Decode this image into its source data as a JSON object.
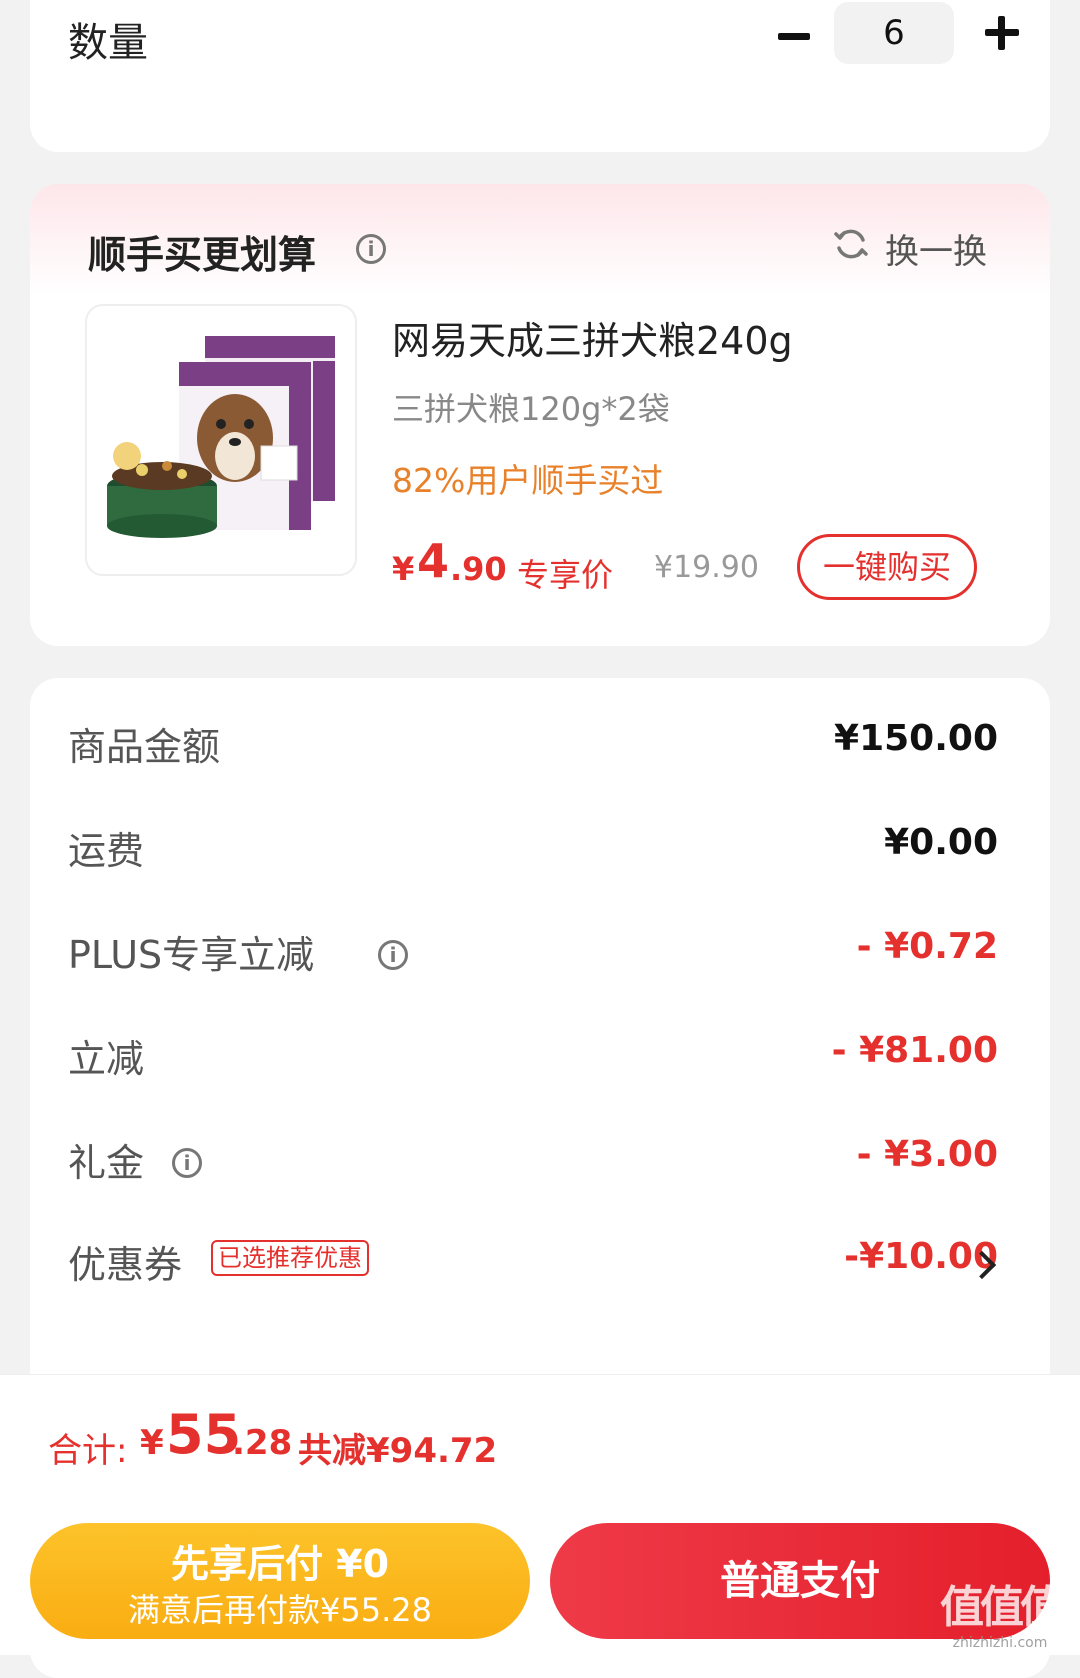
{
  "quantity": {
    "label": "数量",
    "value": "6"
  },
  "upsell": {
    "title": "顺手买更划算",
    "swap_label": "换一换",
    "product": {
      "name": "网易天成三拼犬粮240g",
      "spec": "三拼犬粮120g*2袋",
      "social_proof": "82%用户顺手买过",
      "price_symbol": "¥",
      "price_int": "4",
      "price_dec": ".90",
      "price_tag": "专享价",
      "original_price": "¥19.90",
      "buy_label": "一键购买"
    }
  },
  "summary": {
    "rows": [
      {
        "label": "商品金额",
        "value": "¥150.00"
      },
      {
        "label": "运费",
        "value": "¥0.00"
      },
      {
        "label": "PLUS专享立减",
        "value": "- ¥0.72"
      },
      {
        "label": "立减",
        "value": "- ¥81.00"
      },
      {
        "label": "礼金",
        "value": "- ¥3.00"
      },
      {
        "label": "优惠券",
        "value": "-¥10.00",
        "badge": "已选推荐优惠"
      }
    ]
  },
  "total": {
    "label": "合计:",
    "symbol": "¥",
    "int": "55",
    "dec": ".28",
    "saved": "共减¥94.72"
  },
  "actions": {
    "pay_later_main": "先享后付 ¥0",
    "pay_later_sub": "满意后再付款¥55.28",
    "pay_normal": "普通支付"
  },
  "watermark": {
    "text": "值值值",
    "domain": "zhizhizhi.com"
  },
  "colors": {
    "accent_red": "#e4312e",
    "orange": "#e8812a",
    "pay_later_yellow": "#fdc32a"
  }
}
